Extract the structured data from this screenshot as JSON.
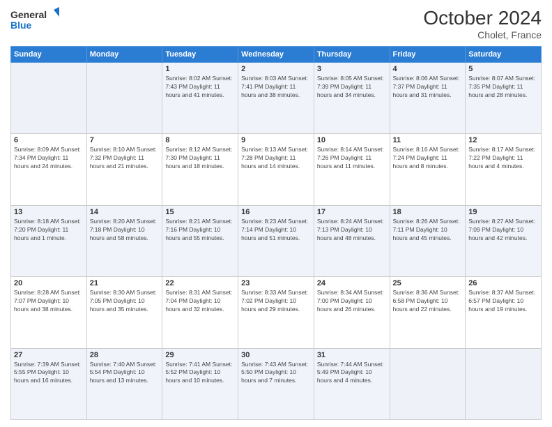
{
  "header": {
    "logo_line1": "General",
    "logo_line2": "Blue",
    "month": "October 2024",
    "location": "Cholet, France"
  },
  "days_of_week": [
    "Sunday",
    "Monday",
    "Tuesday",
    "Wednesday",
    "Thursday",
    "Friday",
    "Saturday"
  ],
  "weeks": [
    [
      {
        "day": "",
        "info": ""
      },
      {
        "day": "",
        "info": ""
      },
      {
        "day": "1",
        "info": "Sunrise: 8:02 AM\nSunset: 7:43 PM\nDaylight: 11 hours and 41 minutes."
      },
      {
        "day": "2",
        "info": "Sunrise: 8:03 AM\nSunset: 7:41 PM\nDaylight: 11 hours and 38 minutes."
      },
      {
        "day": "3",
        "info": "Sunrise: 8:05 AM\nSunset: 7:39 PM\nDaylight: 11 hours and 34 minutes."
      },
      {
        "day": "4",
        "info": "Sunrise: 8:06 AM\nSunset: 7:37 PM\nDaylight: 11 hours and 31 minutes."
      },
      {
        "day": "5",
        "info": "Sunrise: 8:07 AM\nSunset: 7:35 PM\nDaylight: 11 hours and 28 minutes."
      }
    ],
    [
      {
        "day": "6",
        "info": "Sunrise: 8:09 AM\nSunset: 7:34 PM\nDaylight: 11 hours and 24 minutes."
      },
      {
        "day": "7",
        "info": "Sunrise: 8:10 AM\nSunset: 7:32 PM\nDaylight: 11 hours and 21 minutes."
      },
      {
        "day": "8",
        "info": "Sunrise: 8:12 AM\nSunset: 7:30 PM\nDaylight: 11 hours and 18 minutes."
      },
      {
        "day": "9",
        "info": "Sunrise: 8:13 AM\nSunset: 7:28 PM\nDaylight: 11 hours and 14 minutes."
      },
      {
        "day": "10",
        "info": "Sunrise: 8:14 AM\nSunset: 7:26 PM\nDaylight: 11 hours and 11 minutes."
      },
      {
        "day": "11",
        "info": "Sunrise: 8:16 AM\nSunset: 7:24 PM\nDaylight: 11 hours and 8 minutes."
      },
      {
        "day": "12",
        "info": "Sunrise: 8:17 AM\nSunset: 7:22 PM\nDaylight: 11 hours and 4 minutes."
      }
    ],
    [
      {
        "day": "13",
        "info": "Sunrise: 8:18 AM\nSunset: 7:20 PM\nDaylight: 11 hours and 1 minute."
      },
      {
        "day": "14",
        "info": "Sunrise: 8:20 AM\nSunset: 7:18 PM\nDaylight: 10 hours and 58 minutes."
      },
      {
        "day": "15",
        "info": "Sunrise: 8:21 AM\nSunset: 7:16 PM\nDaylight: 10 hours and 55 minutes."
      },
      {
        "day": "16",
        "info": "Sunrise: 8:23 AM\nSunset: 7:14 PM\nDaylight: 10 hours and 51 minutes."
      },
      {
        "day": "17",
        "info": "Sunrise: 8:24 AM\nSunset: 7:13 PM\nDaylight: 10 hours and 48 minutes."
      },
      {
        "day": "18",
        "info": "Sunrise: 8:26 AM\nSunset: 7:11 PM\nDaylight: 10 hours and 45 minutes."
      },
      {
        "day": "19",
        "info": "Sunrise: 8:27 AM\nSunset: 7:09 PM\nDaylight: 10 hours and 42 minutes."
      }
    ],
    [
      {
        "day": "20",
        "info": "Sunrise: 8:28 AM\nSunset: 7:07 PM\nDaylight: 10 hours and 38 minutes."
      },
      {
        "day": "21",
        "info": "Sunrise: 8:30 AM\nSunset: 7:05 PM\nDaylight: 10 hours and 35 minutes."
      },
      {
        "day": "22",
        "info": "Sunrise: 8:31 AM\nSunset: 7:04 PM\nDaylight: 10 hours and 32 minutes."
      },
      {
        "day": "23",
        "info": "Sunrise: 8:33 AM\nSunset: 7:02 PM\nDaylight: 10 hours and 29 minutes."
      },
      {
        "day": "24",
        "info": "Sunrise: 8:34 AM\nSunset: 7:00 PM\nDaylight: 10 hours and 26 minutes."
      },
      {
        "day": "25",
        "info": "Sunrise: 8:36 AM\nSunset: 6:58 PM\nDaylight: 10 hours and 22 minutes."
      },
      {
        "day": "26",
        "info": "Sunrise: 8:37 AM\nSunset: 6:57 PM\nDaylight: 10 hours and 19 minutes."
      }
    ],
    [
      {
        "day": "27",
        "info": "Sunrise: 7:39 AM\nSunset: 5:55 PM\nDaylight: 10 hours and 16 minutes."
      },
      {
        "day": "28",
        "info": "Sunrise: 7:40 AM\nSunset: 5:54 PM\nDaylight: 10 hours and 13 minutes."
      },
      {
        "day": "29",
        "info": "Sunrise: 7:41 AM\nSunset: 5:52 PM\nDaylight: 10 hours and 10 minutes."
      },
      {
        "day": "30",
        "info": "Sunrise: 7:43 AM\nSunset: 5:50 PM\nDaylight: 10 hours and 7 minutes."
      },
      {
        "day": "31",
        "info": "Sunrise: 7:44 AM\nSunset: 5:49 PM\nDaylight: 10 hours and 4 minutes."
      },
      {
        "day": "",
        "info": ""
      },
      {
        "day": "",
        "info": ""
      }
    ]
  ]
}
